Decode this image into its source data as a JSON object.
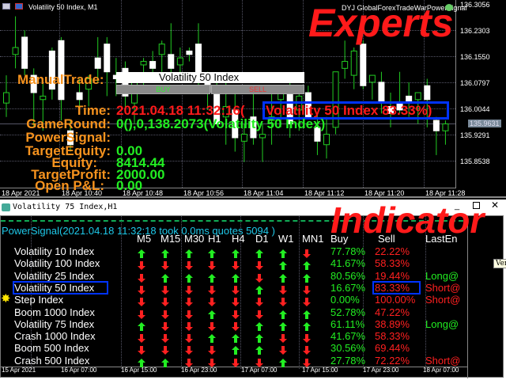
{
  "expert_window": {
    "title": "Volatility 50 Index, M1",
    "ea_name": "DYJ GlobalForexTradeWarPowerSignal",
    "overlay_label": "Experts",
    "price_axis": [
      "136.3056",
      "136.2303",
      "136.1550",
      "136.0797",
      "136.0044",
      "135.9291",
      "135.8538"
    ],
    "current_price": "135.9631",
    "time_axis": [
      "18 Apr 2021",
      "18 Apr 10:40",
      "18 Apr 10:48",
      "18 Apr 10:56",
      "18 Apr 11:04",
      "18 Apr 11:12",
      "18 Apr 11:20",
      "18 Apr 11:28"
    ],
    "manual_trade": {
      "label": "ManualTrade:",
      "symbol_input": "Volatility 50 Index",
      "buy_label": "BUY",
      "sell_label": "SELL"
    },
    "panel": {
      "time_label": "Time:",
      "time_value": "2021.04.18 11:32:16(",
      "signal_highlight": "Volatility 50 Index 83.33%)",
      "gameround_label": "GameRound:",
      "gameround_value": "0(),0,138.2073(Volatility 50 Index)",
      "powersignal_label": "PowerSignal:",
      "targetequity_label": "TargetEquity:",
      "targetequity_value": "0.00",
      "equity_label": "Equity:",
      "equity_value": "8414.44",
      "targetprofit_label": "TargetProfit:",
      "targetprofit_value": "2000.00",
      "openpl_label": "Open P&L:",
      "openpl_value": "0.00"
    },
    "candles": [
      [
        136.02,
        136.1,
        135.98,
        136.05
      ],
      [
        136.16,
        136.27,
        136.12,
        136.18
      ],
      [
        136.21,
        136.23,
        136.1,
        136.12
      ],
      [
        136.1,
        136.12,
        135.95,
        136.05
      ],
      [
        136.03,
        136.08,
        135.94,
        136.04
      ],
      [
        136.17,
        136.18,
        136.03,
        136.06
      ],
      [
        136.2,
        136.21,
        135.97,
        136.03
      ],
      [
        135.94,
        135.97,
        135.88,
        135.9
      ],
      [
        136.05,
        136.09,
        135.99,
        136.03
      ],
      [
        136.06,
        136.1,
        136.01,
        136.09
      ],
      [
        136.15,
        136.21,
        136.08,
        136.12
      ],
      [
        136.19,
        136.21,
        136.04,
        136.11
      ],
      [
        136.1,
        136.15,
        136.04,
        136.09
      ],
      [
        136.12,
        136.14,
        136.0,
        136.04
      ],
      [
        136.02,
        136.06,
        135.96,
        136.1
      ],
      [
        136.13,
        136.15,
        136.06,
        136.14
      ],
      [
        136.14,
        136.17,
        136.09,
        136.12
      ],
      [
        136.16,
        136.2,
        136.11,
        136.19
      ],
      [
        136.16,
        136.25,
        136.1,
        136.12
      ],
      [
        136.13,
        136.18,
        136.1,
        136.15
      ],
      [
        136.17,
        136.18,
        136.14,
        136.16
      ],
      [
        136.19,
        136.25,
        136.05,
        136.09
      ],
      [
        136.09,
        136.11,
        136.0,
        136.05
      ],
      [
        136.05,
        136.09,
        135.98,
        135.96
      ],
      [
        135.98,
        136.1,
        135.9,
        136.01
      ],
      [
        136.0,
        136.06,
        135.88,
        135.92
      ],
      [
        135.91,
        135.96,
        135.85,
        135.93
      ],
      [
        135.98,
        136.05,
        135.9,
        135.92
      ],
      [
        135.92,
        135.96,
        135.85,
        135.93
      ],
      [
        135.97,
        136.07,
        135.9,
        135.98
      ],
      [
        136.03,
        136.07,
        135.95,
        136.06
      ],
      [
        136.07,
        136.09,
        135.92,
        135.96
      ],
      [
        136.0,
        136.06,
        135.94,
        136.04
      ],
      [
        136.05,
        136.07,
        135.99,
        135.98
      ],
      [
        135.95,
        135.99,
        135.87,
        135.91
      ],
      [
        135.9,
        135.98,
        135.86,
        135.93
      ],
      [
        135.95,
        136.11,
        135.93,
        136.11
      ],
      [
        136.12,
        136.2,
        136.09,
        136.14
      ],
      [
        136.1,
        136.18,
        136.06,
        136.17
      ],
      [
        136.19,
        136.2,
        136.06,
        136.07
      ],
      [
        136.08,
        136.1,
        136.03,
        136.1
      ],
      [
        136.08,
        136.11,
        135.99,
        136.02
      ],
      [
        136.01,
        136.05,
        135.95,
        135.99
      ],
      [
        136.02,
        136.11,
        135.99,
        136.0
      ],
      [
        136.04,
        136.08,
        135.98,
        136.02
      ],
      [
        136.03,
        136.05,
        135.96,
        136.05
      ],
      [
        136.07,
        136.09,
        135.95,
        136.03
      ],
      [
        135.97,
        135.98,
        135.87,
        135.94
      ],
      [
        135.94,
        135.97,
        135.9,
        135.96
      ]
    ]
  },
  "indicator_window": {
    "title": "Volatility 75 Index,H1",
    "overlay_label": "Indicator",
    "tooltip": "Ver",
    "status_line": "PowerSignal(2021.04.18 11:32:18 took 0.0ms quotes 5094 )",
    "columns": [
      "M5",
      "M15",
      "M30",
      "H1",
      "H4",
      "D1",
      "W1",
      "MN1",
      "Buy",
      "Sell",
      "LastEn"
    ],
    "rows": [
      {
        "symbol": "Volatility 10 Index",
        "signals": [
          "up",
          "up",
          "up",
          "up",
          "up",
          "up",
          "up",
          "down"
        ],
        "buy": "77.78%",
        "sell": "22.22%",
        "last": ""
      },
      {
        "symbol": "Volatility 100 Index",
        "signals": [
          "down",
          "down",
          "down",
          "down",
          "down",
          "down",
          "up",
          "up"
        ],
        "buy": "41.67%",
        "sell": "58.33%",
        "last": ""
      },
      {
        "symbol": "Volatility 25 Index",
        "signals": [
          "down",
          "up",
          "up",
          "up",
          "up",
          "down",
          "up",
          "up"
        ],
        "buy": "80.56%",
        "sell": "19.44%",
        "last": "Long@"
      },
      {
        "symbol": "Volatility 50 Index",
        "signals": [
          "down",
          "down",
          "down",
          "down",
          "down",
          "up",
          "down",
          "down"
        ],
        "buy": "16.67%",
        "sell": "83.33%",
        "last": "Short@"
      },
      {
        "symbol": "Step Index",
        "signals": [
          "down",
          "down",
          "down",
          "down",
          "down",
          "down",
          "down",
          "down"
        ],
        "buy": "0.00%",
        "sell": "100.00%",
        "last": "Short@"
      },
      {
        "symbol": "Boom 1000 Index",
        "signals": [
          "down",
          "down",
          "down",
          "up",
          "down",
          "down",
          "up",
          "up"
        ],
        "buy": "52.78%",
        "sell": "47.22%",
        "last": ""
      },
      {
        "symbol": "Volatility 75 Index",
        "signals": [
          "up",
          "down",
          "down",
          "down",
          "down",
          "up",
          "up",
          "up"
        ],
        "buy": "61.11%",
        "sell": "38.89%",
        "last": "Long@"
      },
      {
        "symbol": "Crash 1000 Index",
        "signals": [
          "down",
          "down",
          "down",
          "up",
          "up",
          "up",
          "down",
          "down"
        ],
        "buy": "41.67%",
        "sell": "58.33%",
        "last": ""
      },
      {
        "symbol": "Boom 500 Index",
        "signals": [
          "down",
          "down",
          "down",
          "down",
          "up",
          "up",
          "down",
          "down"
        ],
        "buy": "30.56%",
        "sell": "69.44%",
        "last": ""
      },
      {
        "symbol": "Crash 500 Index",
        "signals": [
          "up",
          "up",
          "down",
          "down",
          "down",
          "down",
          "up",
          "down"
        ],
        "buy": "27.78%",
        "sell": "72.22%",
        "last": "Short@"
      }
    ],
    "time_axis": [
      "15 Apr 2021",
      "16 Apr 07:00",
      "16 Apr 15:00",
      "16 Apr 23:00",
      "17 Apr 07:00",
      "17 Apr 15:00",
      "17 Apr 23:00",
      "18 Apr 07:00"
    ],
    "colors": {
      "up": "#22ee22",
      "down": "#ff2020",
      "accent": "#0033ff"
    }
  }
}
